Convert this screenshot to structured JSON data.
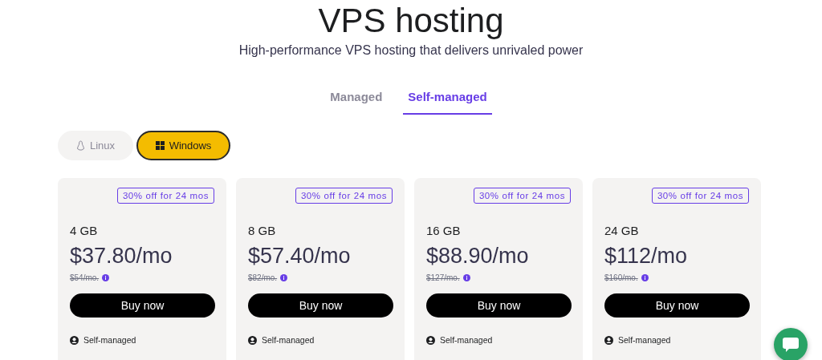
{
  "header": {
    "title": "VPS hosting",
    "subtitle": "High-performance VPS hosting that delivers unrivaled power"
  },
  "tabs": [
    {
      "label": "Managed",
      "selected": false
    },
    {
      "label": "Self-managed",
      "selected": true
    }
  ],
  "os_options": [
    {
      "label": "Linux",
      "kind": "linux",
      "selected": false
    },
    {
      "label": "Windows",
      "kind": "windows",
      "selected": true
    }
  ],
  "plans": [
    {
      "badge": "30% off for 24 mos",
      "memory": "4 GB",
      "price": "$37.80/mo",
      "old_price": "$54/mo.",
      "button": "Buy now",
      "feature": "Self-managed"
    },
    {
      "badge": "30% off for 24 mos",
      "memory": "8 GB",
      "price": "$57.40/mo",
      "old_price": "$82/mo.",
      "button": "Buy now",
      "feature": "Self-managed"
    },
    {
      "badge": "30% off for 24 mos",
      "memory": "16 GB",
      "price": "$88.90/mo",
      "old_price": "$127/mo.",
      "button": "Buy now",
      "feature": "Self-managed"
    },
    {
      "badge": "30% off for 24 mos",
      "memory": "24 GB",
      "price": "$112/mo",
      "old_price": "$160/mo.",
      "button": "Buy now",
      "feature": "Self-managed"
    }
  ]
}
